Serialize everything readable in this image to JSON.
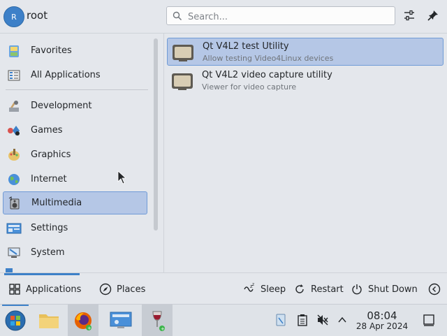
{
  "header": {
    "avatar_initial": "R",
    "username": "root",
    "search_placeholder": "Search..."
  },
  "sidebar": {
    "items": [
      {
        "label": "Favorites"
      },
      {
        "label": "All Applications"
      },
      {
        "label": "Development"
      },
      {
        "label": "Games"
      },
      {
        "label": "Graphics"
      },
      {
        "label": "Internet"
      },
      {
        "label": "Multimedia",
        "selected": true
      },
      {
        "label": "Settings"
      },
      {
        "label": "System"
      }
    ]
  },
  "apps": [
    {
      "name": "Qt V4L2 test Utility",
      "description": "Allow testing Video4Linux devices",
      "selected": true
    },
    {
      "name": "Qt V4L2 video capture utility",
      "description": "Viewer for video capture"
    }
  ],
  "footer": {
    "applications_label": "Applications",
    "places_label": "Places",
    "sleep_label": "Sleep",
    "restart_label": "Restart",
    "shutdown_label": "Shut Down"
  },
  "taskbar": {
    "time": "08:04",
    "date": "28 Apr 2024"
  },
  "colors": {
    "accent": "#3d80c8",
    "selection": "#b5c7e6"
  }
}
